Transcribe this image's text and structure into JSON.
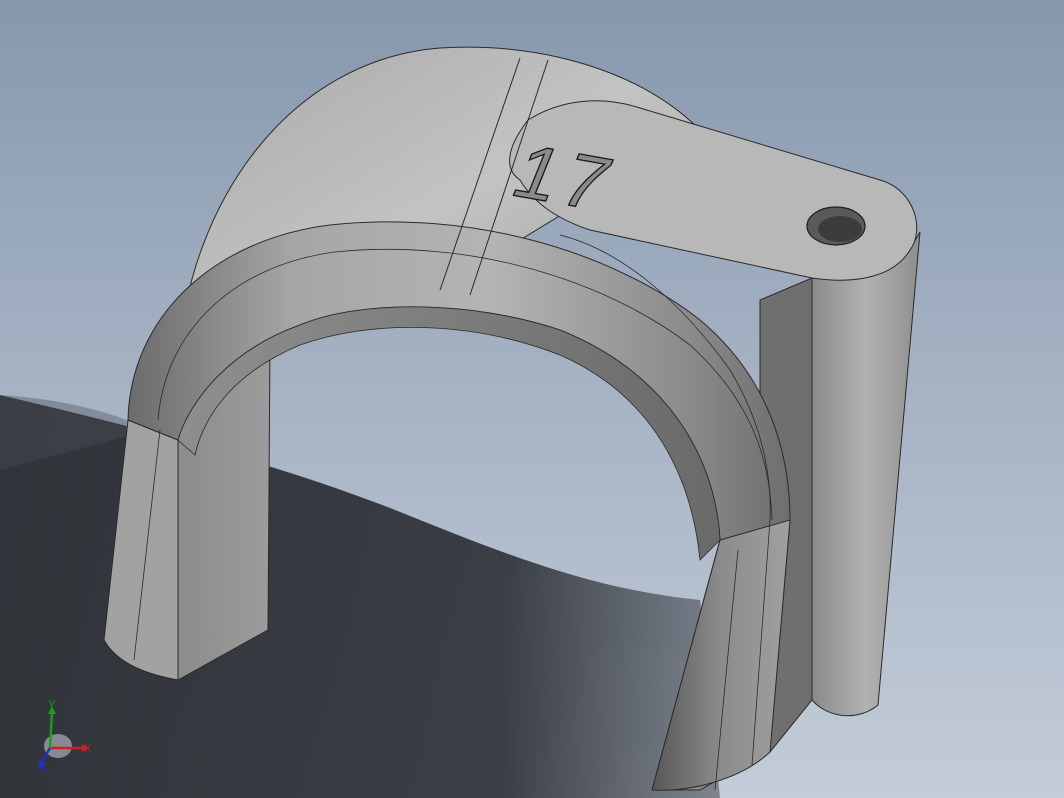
{
  "viewport": {
    "part_label": "17"
  },
  "triad": {
    "x_label": "X",
    "y_label": "Y",
    "z_label": "Z",
    "x_color": "#d02020",
    "y_color": "#18a018",
    "z_color": "#2030c8"
  }
}
